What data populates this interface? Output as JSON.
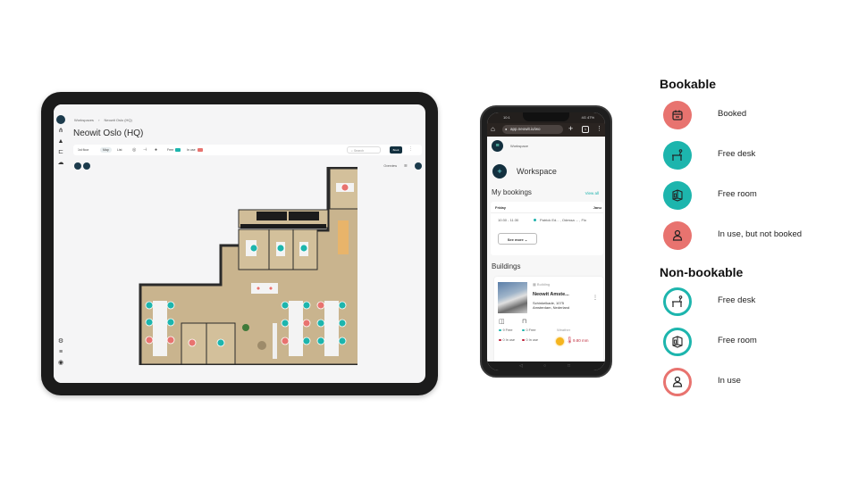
{
  "colors": {
    "booked": "#e8736f",
    "free": "#1db5ad",
    "dark_navy": "#13303f",
    "accent_link": "#1fb2ad"
  },
  "tablet": {
    "breadcrumb": [
      "Workspaces",
      "›",
      "Neowit Oslo (HQ)"
    ],
    "title": "Neowit Oslo (HQ)",
    "toolbar": {
      "chips": [
        "1st floor",
        "Map",
        "List"
      ],
      "free_label": "Free",
      "inuse_label": "In use",
      "search_placeholder": "Search",
      "book_button": "Book"
    },
    "overview_label": "Overview",
    "rail_icons": [
      "logo",
      "network-icon",
      "building-icon",
      "desk-icon",
      "cloud-icon",
      "settings-icon",
      "help-icon",
      "user-icon"
    ]
  },
  "phone": {
    "status_time": "10:1",
    "status_right": "4G 47%",
    "url": "app.neowit.io/wo",
    "breadcrumb": "Workspace",
    "heading": "Workspace",
    "my_bookings": "My bookings",
    "view_all": "View all",
    "booking": {
      "day": "Friday",
      "day_right": "Janu",
      "time": "10:30 - 11:30",
      "details": "Patrick Ed... , Odessa ... , Flo"
    },
    "see_more": "See more",
    "buildings_heading": "Buildings",
    "building": {
      "tag": "Building",
      "name": "Neowit Amste...",
      "address": "Schinkelkade, 1075 Amsterdam, Nederland",
      "rooms_free": "9 Free",
      "desks_free": "0 Free",
      "rooms_in_use": "0 In use",
      "desks_in_use": "0 In use",
      "weather_label": "Weather",
      "rain": "9.80 mm"
    }
  },
  "legend": {
    "bookable_title": "Bookable",
    "bookable": [
      {
        "label": "Booked",
        "icon": "calendar-icon",
        "state": "booked",
        "style": "filled"
      },
      {
        "label": "Free desk",
        "icon": "desk-icon",
        "state": "free",
        "style": "filled"
      },
      {
        "label": "Free room",
        "icon": "room-icon",
        "state": "free",
        "style": "filled"
      },
      {
        "label": "In use, but not booked",
        "icon": "person-icon",
        "state": "booked",
        "style": "filled"
      }
    ],
    "nonbookable_title": "Non-bookable",
    "nonbookable": [
      {
        "label": "Free desk",
        "icon": "desk-icon",
        "state": "free",
        "style": "outline"
      },
      {
        "label": "Free room",
        "icon": "room-icon",
        "state": "free",
        "style": "outline"
      },
      {
        "label": "In use",
        "icon": "person-icon",
        "state": "booked",
        "style": "outline"
      }
    ]
  },
  "floorplan": {
    "markers": [
      {
        "state": "booked"
      },
      {
        "state": "free"
      },
      {
        "state": "free"
      },
      {
        "state": "free"
      },
      {
        "state": "booked"
      },
      {
        "state": "booked"
      },
      {
        "state": "free"
      },
      {
        "state": "free"
      },
      {
        "state": "free"
      },
      {
        "state": "free"
      },
      {
        "state": "booked"
      },
      {
        "state": "booked"
      },
      {
        "state": "booked"
      },
      {
        "state": "free"
      },
      {
        "state": "free"
      },
      {
        "state": "free"
      },
      {
        "state": "free"
      },
      {
        "state": "booked"
      },
      {
        "state": "booked"
      },
      {
        "state": "free"
      },
      {
        "state": "booked"
      },
      {
        "state": "free"
      },
      {
        "state": "free"
      },
      {
        "state": "free"
      },
      {
        "state": "free"
      },
      {
        "state": "free"
      }
    ]
  }
}
